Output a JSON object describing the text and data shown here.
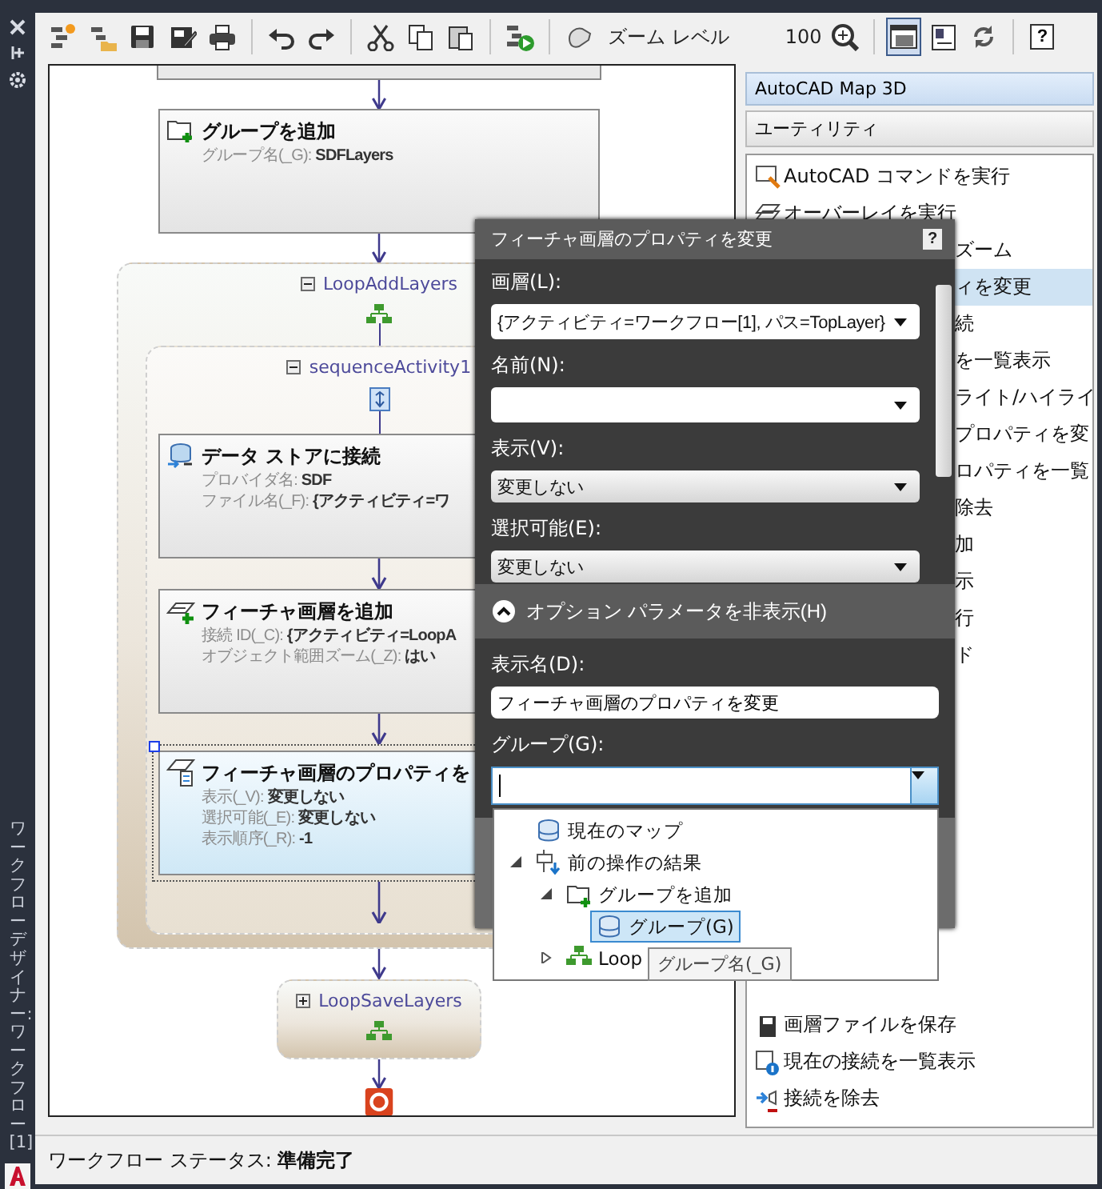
{
  "window": {
    "side_title": "ワークフローデザイナー:ワークフロー[1]"
  },
  "toolbar": {
    "buttons": [
      {
        "kind": "new",
        "pressed": false
      },
      {
        "kind": "open",
        "pressed": false
      },
      {
        "kind": "save",
        "pressed": false
      },
      {
        "kind": "edit",
        "pressed": false
      },
      {
        "kind": "print",
        "pressed": false
      },
      {
        "kind": "sep"
      },
      {
        "kind": "undo",
        "pressed": false
      },
      {
        "kind": "redo",
        "pressed": false
      },
      {
        "kind": "sep"
      },
      {
        "kind": "cut",
        "pressed": false
      },
      {
        "kind": "copy",
        "pressed": false
      },
      {
        "kind": "paste",
        "pressed": false
      },
      {
        "kind": "sep"
      },
      {
        "kind": "run",
        "pressed": false
      },
      {
        "kind": "sep"
      },
      {
        "kind": "pan",
        "pressed": false
      },
      {
        "kind": "zoom_label",
        "label": "ズーム レベル"
      },
      {
        "kind": "zoom_value",
        "label": "100"
      },
      {
        "kind": "zoom",
        "pressed": false
      },
      {
        "kind": "sep"
      },
      {
        "kind": "designer",
        "pressed": true
      },
      {
        "kind": "panel",
        "pressed": false
      },
      {
        "kind": "refresh",
        "pressed": false
      },
      {
        "kind": "sep"
      },
      {
        "kind": "help",
        "label": "?",
        "pressed": false
      }
    ]
  },
  "workflow": {
    "steps": [
      {
        "kind": "stub"
      },
      {
        "kind": "add_group",
        "title": "グループを追加",
        "lines": [
          "グループ名(_G): **SDFLayers**"
        ],
        "selected": false
      },
      {
        "kind": "loop",
        "name": "LoopAddLayers",
        "expanded": true,
        "children": [
          {
            "kind": "sequence",
            "name": "sequenceActivity1",
            "expanded": true,
            "children": [
              {
                "kind": "connect_store",
                "title": "データ ストアに接続",
                "lines": [
                  "プロバイダ名: **SDF**",
                  "ファイル名(_F): **{アクティビティ=ワ**"
                ],
                "selected": false
              },
              {
                "kind": "add_layer",
                "title": "フィーチャ画層を追加",
                "lines": [
                  "接続 ID(_C): **{アクティビティ=LoopA**",
                  "オブジェクト範囲ズーム(_Z): **はい**"
                ],
                "selected": false
              },
              {
                "kind": "layer_props",
                "title": "フィーチャ画層のプロパティを",
                "lines": [
                  "表示(_V): **変更しない**",
                  "選択可能(_E): **変更しない**",
                  "表示順序(_R): **-1**"
                ],
                "selected": true
              }
            ]
          }
        ]
      },
      {
        "kind": "loop",
        "name": "LoopSaveLayers",
        "expanded": false
      },
      {
        "kind": "end"
      }
    ]
  },
  "utilities": {
    "title": "AutoCAD Map 3D",
    "section": "ユーティリティ",
    "items": [
      {
        "kind": "run_command",
        "label": "AutoCAD コマンドを実行",
        "selected": false
      },
      {
        "kind": "overlay",
        "label": "オーバーレイを実行",
        "selected": false
      },
      {
        "kind": "partial",
        "label": "ズーム",
        "selected": false
      },
      {
        "kind": "partial",
        "label": "ィを変更",
        "selected": true
      },
      {
        "kind": "partial",
        "label": "続",
        "selected": false
      },
      {
        "kind": "partial",
        "label": "を一覧表示",
        "selected": false
      },
      {
        "kind": "partial",
        "label": "ライト/ハイライ",
        "selected": false
      },
      {
        "kind": "partial",
        "label": "プロパティを変",
        "selected": false
      },
      {
        "kind": "partial",
        "label": "ロパティを一覧",
        "selected": false
      },
      {
        "kind": "partial",
        "label": "除去",
        "selected": false
      },
      {
        "kind": "partial",
        "label": "加",
        "selected": false
      },
      {
        "kind": "partial",
        "label": "示",
        "selected": false
      },
      {
        "kind": "partial",
        "label": "行",
        "selected": false
      },
      {
        "kind": "partial",
        "label": "ド",
        "selected": false
      },
      {
        "kind": "save_layer",
        "label": "画層ファイルを保存",
        "selected": false
      },
      {
        "kind": "list_connections",
        "label": "現在の接続を一覧表示",
        "selected": false
      },
      {
        "kind": "remove_connection",
        "label": "接続を除去",
        "selected": false
      }
    ]
  },
  "dialog": {
    "title": "フィーチャ画層のプロパティを変更",
    "help": "?",
    "fields": [
      {
        "kind": "combo",
        "label": "画層(L):",
        "value": "{アクティビティ=ワークフロー[1], パス=TopLayer}"
      },
      {
        "kind": "combo",
        "label": "名前(N):"
      },
      {
        "kind": "choice",
        "label": "表示(V):",
        "value": "変更しない"
      },
      {
        "kind": "choice",
        "label": "選択可能(E):",
        "value": "変更しない"
      }
    ],
    "options_toggle": {
      "label": "オプション パラメータを非表示(H)",
      "expanded": true
    },
    "options": [
      {
        "kind": "text",
        "label": "表示名(D):",
        "value": "フィーチャ画層のプロパティを変更"
      },
      {
        "kind": "combo_open",
        "label": "グループ(G):"
      }
    ],
    "dropdown": [
      {
        "kind": "map",
        "label": "現在のマップ",
        "selected": false
      },
      {
        "kind": "results",
        "label": "前の操作の結果",
        "selected": false,
        "expanded": true,
        "children": [
          {
            "kind": "add_group",
            "label": "グループを追加",
            "selected": false,
            "expanded": true,
            "children": [
              {
                "kind": "group",
                "label": "グループ(G)",
                "selected": true
              }
            ]
          },
          {
            "kind": "loop",
            "label": "Loop",
            "selected": false,
            "expanded": false
          }
        ]
      }
    ],
    "tooltip": "グループ名(_G)"
  },
  "status": "ワークフロー ステータス: **準備完了**"
}
